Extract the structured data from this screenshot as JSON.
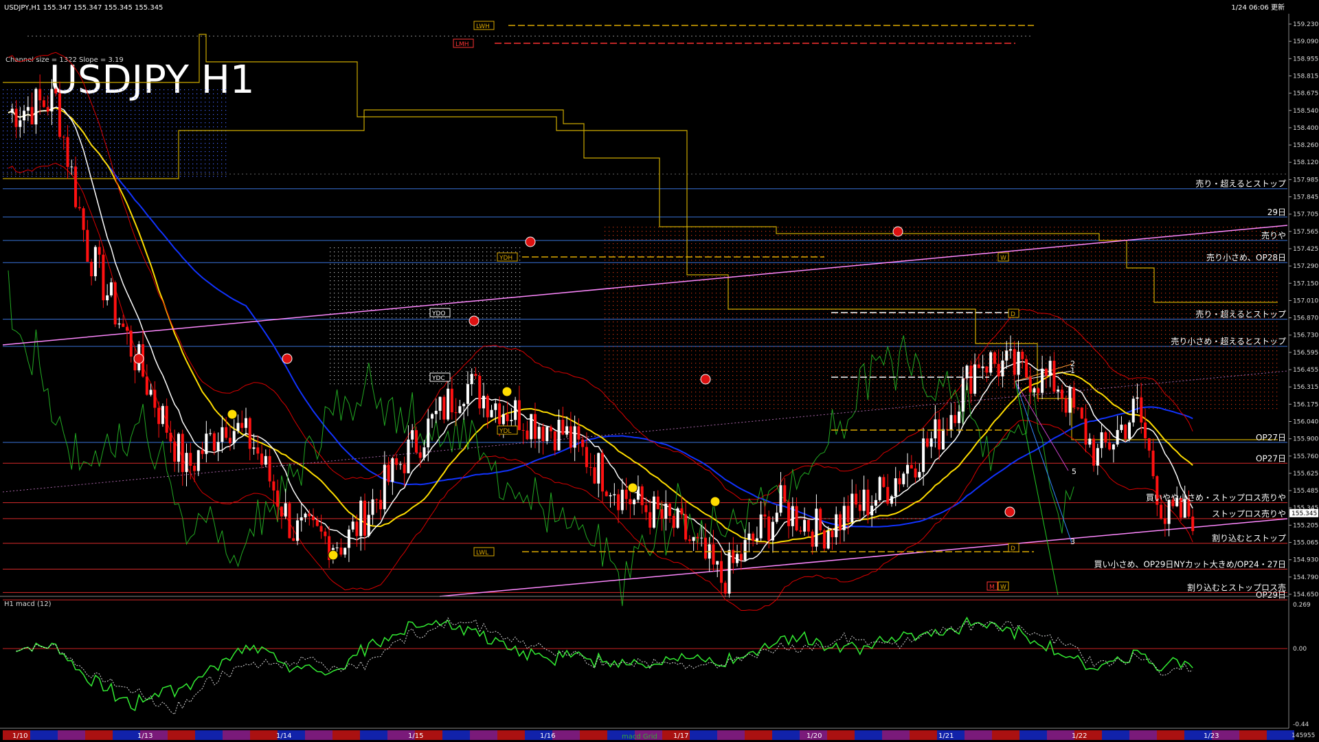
{
  "window": {
    "header_left": "USDJPY,H1  155.347 155.347 155.345 155.345",
    "header_right": "1/24 06:06 更新",
    "channel_info": "Channel size = 1322 Slope = 3.19",
    "big_title": "USDJPY H1"
  },
  "chart_data": {
    "type": "candlestick",
    "title": "USDJPY H1",
    "price_axis": {
      "ylim": [
        154.68,
        159.29
      ],
      "ticks": [
        "159.230",
        "159.090",
        "158.955",
        "158.815",
        "158.675",
        "158.540",
        "158.400",
        "158.260",
        "158.120",
        "157.985",
        "157.845",
        "157.705",
        "157.565",
        "157.425",
        "157.290",
        "157.150",
        "157.010",
        "156.870",
        "156.730",
        "156.595",
        "156.455",
        "156.315",
        "156.175",
        "156.040",
        "155.900",
        "155.760",
        "155.625",
        "155.485",
        "155.345",
        "155.205",
        "155.065",
        "154.930",
        "154.790",
        "154.650"
      ],
      "current_price": "155.345"
    },
    "time_axis": {
      "labels": [
        "1/10",
        "1/13",
        "1/14",
        "1/15",
        "1/16",
        "1/17",
        "1/20",
        "1/21",
        "1/22",
        "1/23"
      ]
    },
    "level_labels": [
      {
        "text": "売り・超えるとストップ",
        "price": 157.98,
        "color": "#4488ff"
      },
      {
        "text": "29日",
        "price": 157.75,
        "color": "#4488ff"
      },
      {
        "text": "売りや",
        "price": 157.56,
        "color": "#4488ff"
      },
      {
        "text": "売り小さめ、OP28日",
        "price": 157.38,
        "color": "#4488ff"
      },
      {
        "text": "売り・超えるとストップ",
        "price": 156.92,
        "color": "#4488ff"
      },
      {
        "text": "売り小さめ・超えるとストップ",
        "price": 156.7,
        "color": "#4488ff"
      },
      {
        "text": "OP27日",
        "price": 155.92,
        "color": "#4488ff"
      },
      {
        "text": "OP27日",
        "price": 155.75,
        "color": "#ff3333"
      },
      {
        "text": "買いやや小さめ・ストップロス売りや",
        "price": 155.43,
        "color": "#ff3333"
      },
      {
        "text": "ストップロス売りや",
        "price": 155.3,
        "color": "#ff3333"
      },
      {
        "text": "割り込むとストップ",
        "price": 155.1,
        "color": "#ff3333"
      },
      {
        "text": "買い小さめ、OP29日NYカット大きめ/OP24・27日",
        "price": 154.89,
        "color": "#ff3333"
      },
      {
        "text": "割り込むとストップロス売",
        "price": 154.7,
        "color": "#ff3333"
      },
      {
        "text": "OP29日",
        "price": 154.64,
        "color": "#ff3333"
      }
    ],
    "tags": [
      {
        "text": "LWH",
        "color": "#ddaa00"
      },
      {
        "text": "LMH",
        "color": "#ff3333"
      },
      {
        "text": "YDH",
        "color": "#ddaa00"
      },
      {
        "text": "YDO",
        "color": "#ffffff"
      },
      {
        "text": "YDC",
        "color": "#ffffff"
      },
      {
        "text": "YDL",
        "color": "#ddaa00"
      },
      {
        "text": "LWL",
        "color": "#ddaa00"
      },
      {
        "text": "W",
        "color": "#ddaa00"
      },
      {
        "text": "D",
        "color": "#ddaa00"
      },
      {
        "text": "D",
        "color": "#ddaa00"
      },
      {
        "text": "M",
        "color": "#ff3333"
      },
      {
        "text": "W",
        "color": "#ddaa00"
      }
    ],
    "fib_numbers": [
      "2",
      "1",
      "5",
      "3"
    ],
    "macd": {
      "label": "H1  macd (12)",
      "ticks": [
        "0.269",
        "0.00",
        "-0.44"
      ],
      "subtext": "macd Grid"
    },
    "bottom_right": "145955",
    "colors": {
      "bull": "#ffffff",
      "bear": "#ff1111",
      "ma_white": "#ffffff",
      "ma_yellow": "#ffdd00",
      "ma_blue": "#1133ff",
      "trend_pink": "#ff88ff",
      "macd_green": "#33ee33",
      "macd_pink": "#ff88cc",
      "ichimoku_span": "#ccaa00",
      "bollinger": "#dd0000",
      "chikou": "#22aa22"
    }
  }
}
